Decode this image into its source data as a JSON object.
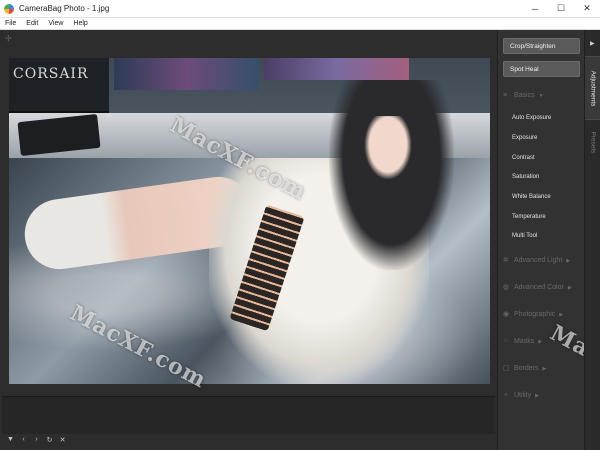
{
  "window": {
    "title": "CameraBag Photo - 1.jpg",
    "controls": {
      "minimize": "─",
      "maximize": "☐",
      "close": "✕"
    }
  },
  "menu": [
    "File",
    "Edit",
    "View",
    "Help"
  ],
  "watermark": "MacXF.com",
  "photo_text": {
    "monitor_brand": "CORSAIR"
  },
  "panel": {
    "crop_button": "Crop/Straighten",
    "heal_button": "Spot Heal",
    "basics": {
      "label": "Basics",
      "items": [
        "Auto Exposure",
        "Exposure",
        "Contrast",
        "Saturation",
        "White Balance",
        "Temperature",
        "Multi Tool"
      ]
    },
    "sections": [
      "Advanced Light",
      "Advanced Color",
      "Photographic",
      "Masks",
      "Borders",
      "Utility"
    ]
  },
  "side_tabs": [
    "Adjustments",
    "Presets"
  ],
  "bottom_controls": [
    "▼",
    "‹",
    "›",
    "↻",
    "✕"
  ],
  "colors": {
    "accent_button": "#5a5a5a",
    "panel_bg": "#323232",
    "canvas_bg": "#2d2d2d"
  }
}
